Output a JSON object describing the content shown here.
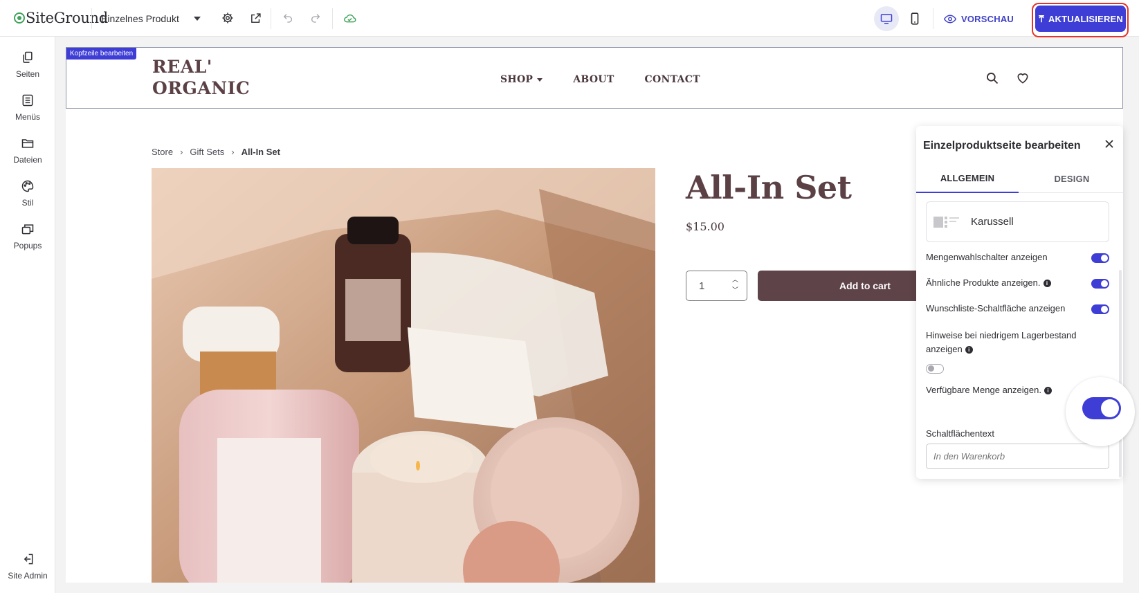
{
  "topbar": {
    "logo": "SiteGround",
    "page_select": "Einzelnes Produkt",
    "preview_label": "VORSCHAU",
    "update_label": "AKTUALISIEREN"
  },
  "sidebar": {
    "items": [
      {
        "label": "Seiten",
        "icon": "pages-icon"
      },
      {
        "label": "Menüs",
        "icon": "menus-icon"
      },
      {
        "label": "Dateien",
        "icon": "folder-icon"
      },
      {
        "label": "Stil",
        "icon": "palette-icon"
      },
      {
        "label": "Popups",
        "icon": "popups-icon"
      }
    ],
    "admin_label": "Site Admin"
  },
  "canvas": {
    "header_tag": "Kopfzeile bearbeiten",
    "site_logo_line1": "REAL'",
    "site_logo_line2": "ORGANIC",
    "nav": [
      "SHOP",
      "ABOUT",
      "CONTACT"
    ],
    "breadcrumb": [
      "Store",
      "Gift Sets",
      "All-In Set"
    ],
    "product_title": "All-In Set",
    "price": "$15.00",
    "quantity": "1",
    "add_to_cart": "Add to cart"
  },
  "panel": {
    "title": "Einzelproduktseite bearbeiten",
    "tabs": [
      "ALLGEMEIN",
      "DESIGN"
    ],
    "layout_option": "Karussell",
    "options": [
      {
        "label": "Mengenwahlschalter anzeigen",
        "on": true
      },
      {
        "label": "Ähnliche Produkte anzeigen.",
        "on": true
      },
      {
        "label": "Wunschliste-Schaltfläche anzeigen",
        "on": true
      },
      {
        "label": "Hinweise bei niedrigem Lagerbestand anzeigen",
        "on": false
      },
      {
        "label": "Verfügbare Menge anzeigen.",
        "on": true
      }
    ],
    "button_text_label": "Schaltflächentext",
    "button_text_placeholder": "In den Warenkorb"
  },
  "colors": {
    "accent": "#3e3ed6",
    "brand_product": "#5b4146",
    "cart_button": "#5e4348",
    "highlight_outline": "#e6332a"
  }
}
